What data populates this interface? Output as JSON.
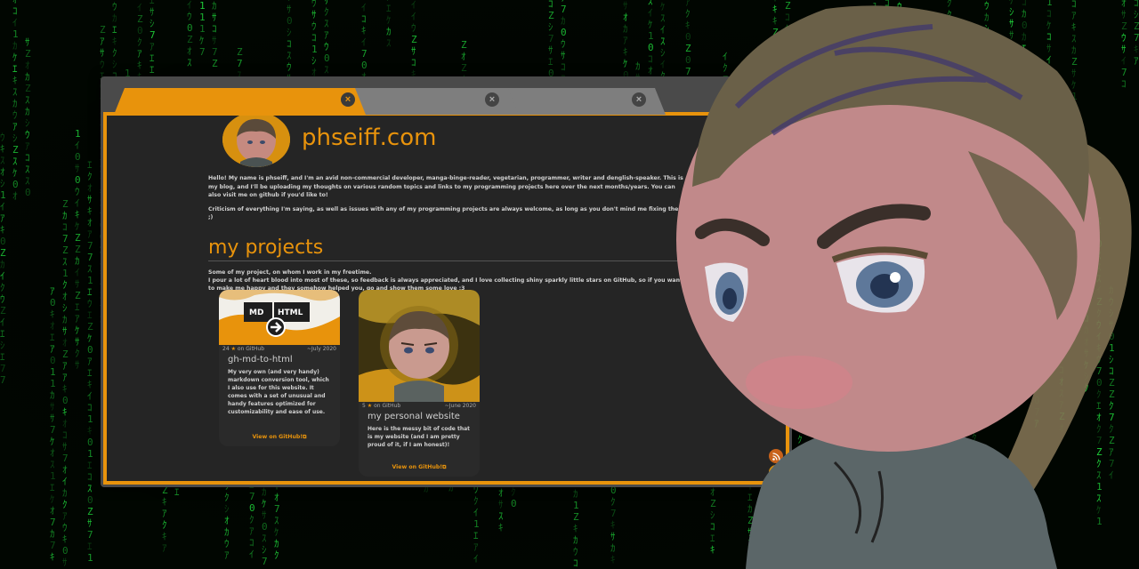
{
  "browser": {
    "tabs": [
      {
        "active": true
      },
      {
        "active": false
      },
      {
        "active": false
      }
    ]
  },
  "site": {
    "title": "phseiff.com",
    "intro": [
      "Hello! My name is phseiff, and I'm an avid non-commercial developer, manga-binge-reader, vegetarian, programmer, writer and denglish-speaker. This is my blog, and I'll be uploading my thoughts on various random topics and links to my programming projects here over the next months/years. You can also visit me on github if you'd like to!",
      "Criticism of everything I'm saying, as well as issues with any of my programming projects are always welcome, as long as you don't mind me fixing them ;)"
    ],
    "projects_title": "my projects",
    "projects_desc_1": "Some of my project, on whom I work in my freetime.",
    "projects_desc_2": "I pour a lot of heart blood into most of these, so feedback is always appreciated, and I love collecting shiny sparkly little stars on GitHub, so if you want to make me happy and they somehow helped you, go and show them some love :3",
    "projects": [
      {
        "stars": "24",
        "stars_suffix": "on GitHub",
        "date": "~July 2020",
        "name": "gh-md-to-html",
        "description": "My very own (and very handy) markdown conversion tool, which I also use for this website. It comes with a set of unusual and handy features optimized for customizability and ease of use.",
        "link": "View on GitHub!",
        "thumb_labels": [
          "MD",
          "HTML"
        ]
      },
      {
        "stars": "5",
        "stars_suffix": "on GitHub",
        "date": "~June 2020",
        "name": "my personal website",
        "description": "Here is the messy bit of code that is my website (and I am pretty proud of it, if I am honest)!",
        "link": "View on GitHub!"
      }
    ]
  },
  "icons": {
    "tab_close": "×",
    "star": "★",
    "external_link": "⧉",
    "rss": "rss-icon",
    "scroll_down": "⌄"
  },
  "colors": {
    "accent": "#e8930c",
    "matrix_green": "#1fd43a",
    "page_bg": "#252525"
  }
}
